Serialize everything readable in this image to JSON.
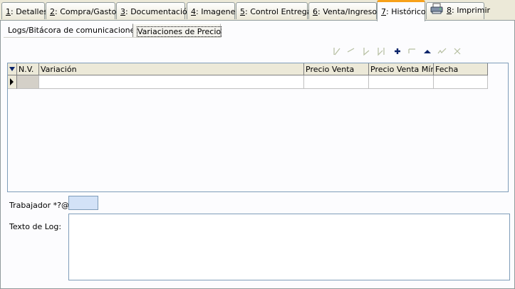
{
  "tabs": [
    {
      "key": "1",
      "rest": ": Detalles"
    },
    {
      "key": "2",
      "rest": ": Compra/Gastos"
    },
    {
      "key": "3",
      "rest": ": Documentación"
    },
    {
      "key": "4",
      "rest": ": Imagenes"
    },
    {
      "key": "5",
      "rest": ": Control Entregas"
    },
    {
      "key": "6",
      "rest": ": Venta/Ingresos"
    },
    {
      "key": "7",
      "rest": ": Histórico"
    },
    {
      "key": "8",
      "rest": ": Imprimir"
    }
  ],
  "subtabs": [
    "Logs/Bitácora de comunicaciones",
    "Variaciones de Precio"
  ],
  "nav_icons": [
    "first-record-icon",
    "prior-record-icon",
    "next-record-icon",
    "last-record-icon",
    "insert-record-icon",
    "delete-record-icon",
    "edit-record-icon",
    "post-edit-icon",
    "cancel-edit-icon"
  ],
  "grid": {
    "columns": [
      "N.V.",
      "Variación",
      "Precio Venta",
      "Precio Venta Mín.",
      "Fecha"
    ],
    "rows": [
      [
        "",
        "",
        "",
        "",
        ""
      ]
    ]
  },
  "form": {
    "trabajador_label": "Trabajador *?@",
    "trabajador_value": "",
    "texto_log_label": "Texto de Log:",
    "texto_log_value": ""
  },
  "colors": {
    "accent_tab": "#f7a11a",
    "nav_enabled": "#0a246a",
    "nav_disabled": "#b5bea0",
    "field_highlight": "#d3e2f7"
  }
}
